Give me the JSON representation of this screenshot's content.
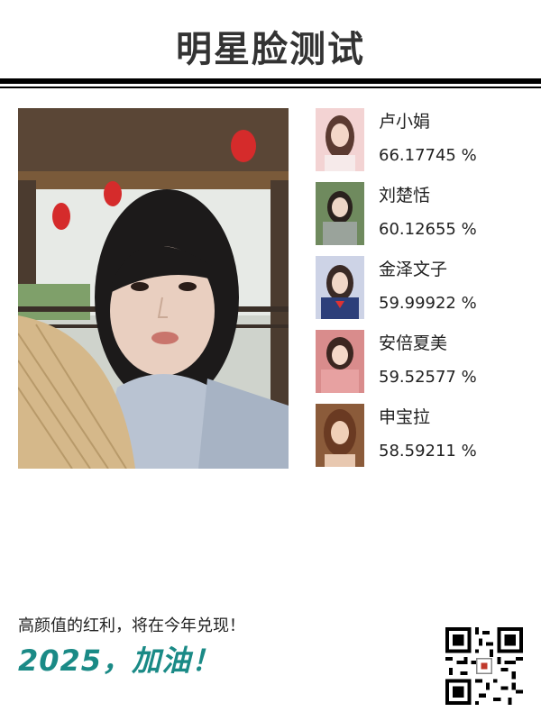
{
  "header": {
    "title": "明星脸测试"
  },
  "matches": [
    {
      "name": "卢小娟",
      "score": "66.17745 %"
    },
    {
      "name": "刘楚恬",
      "score": "60.12655 %"
    },
    {
      "name": "金泽文子",
      "score": "59.99922 %"
    },
    {
      "name": "安倍夏美",
      "score": "59.52577 %"
    },
    {
      "name": "申宝拉",
      "score": "58.59211 %"
    }
  ],
  "footer": {
    "slogan": "高颜值的红利，将在今年兑现！",
    "cheer": "2025，加油！"
  },
  "colors": {
    "title": "#333333",
    "accent": "#1a8a86",
    "rule": "#000000"
  },
  "icons": {
    "qr": "qr-code-icon"
  }
}
